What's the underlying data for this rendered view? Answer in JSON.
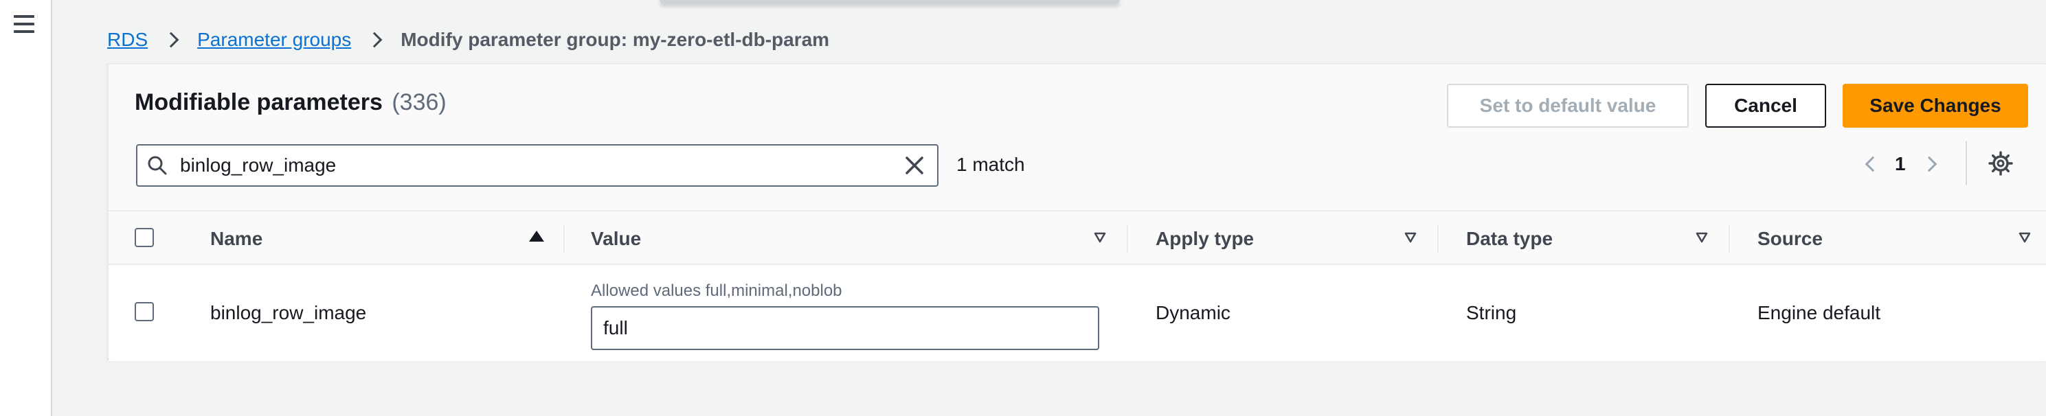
{
  "breadcrumb": {
    "root": "RDS",
    "parent": "Parameter groups",
    "current": "Modify parameter group: my-zero-etl-db-param"
  },
  "panel": {
    "title": "Modifiable parameters",
    "count": "(336)"
  },
  "actions": {
    "default_label": "Set to default value",
    "cancel_label": "Cancel",
    "save_label": "Save Changes"
  },
  "search": {
    "value": "binlog_row_image",
    "match_text": "1 match"
  },
  "pagination": {
    "current_page": "1"
  },
  "table": {
    "columns": [
      "Name",
      "Value",
      "Apply type",
      "Data type",
      "Source"
    ],
    "rows": [
      {
        "name": "binlog_row_image",
        "allowed_values": "Allowed values full,minimal,noblob",
        "value": "full",
        "apply_type": "Dynamic",
        "data_type": "String",
        "source": "Engine default"
      }
    ]
  },
  "colors": {
    "accent": "#ff9900",
    "link": "#0972d3"
  },
  "icons": {
    "menu": "hamburger-menu-icon",
    "search": "search-icon",
    "clear": "close-icon",
    "settings": "gear-icon"
  }
}
